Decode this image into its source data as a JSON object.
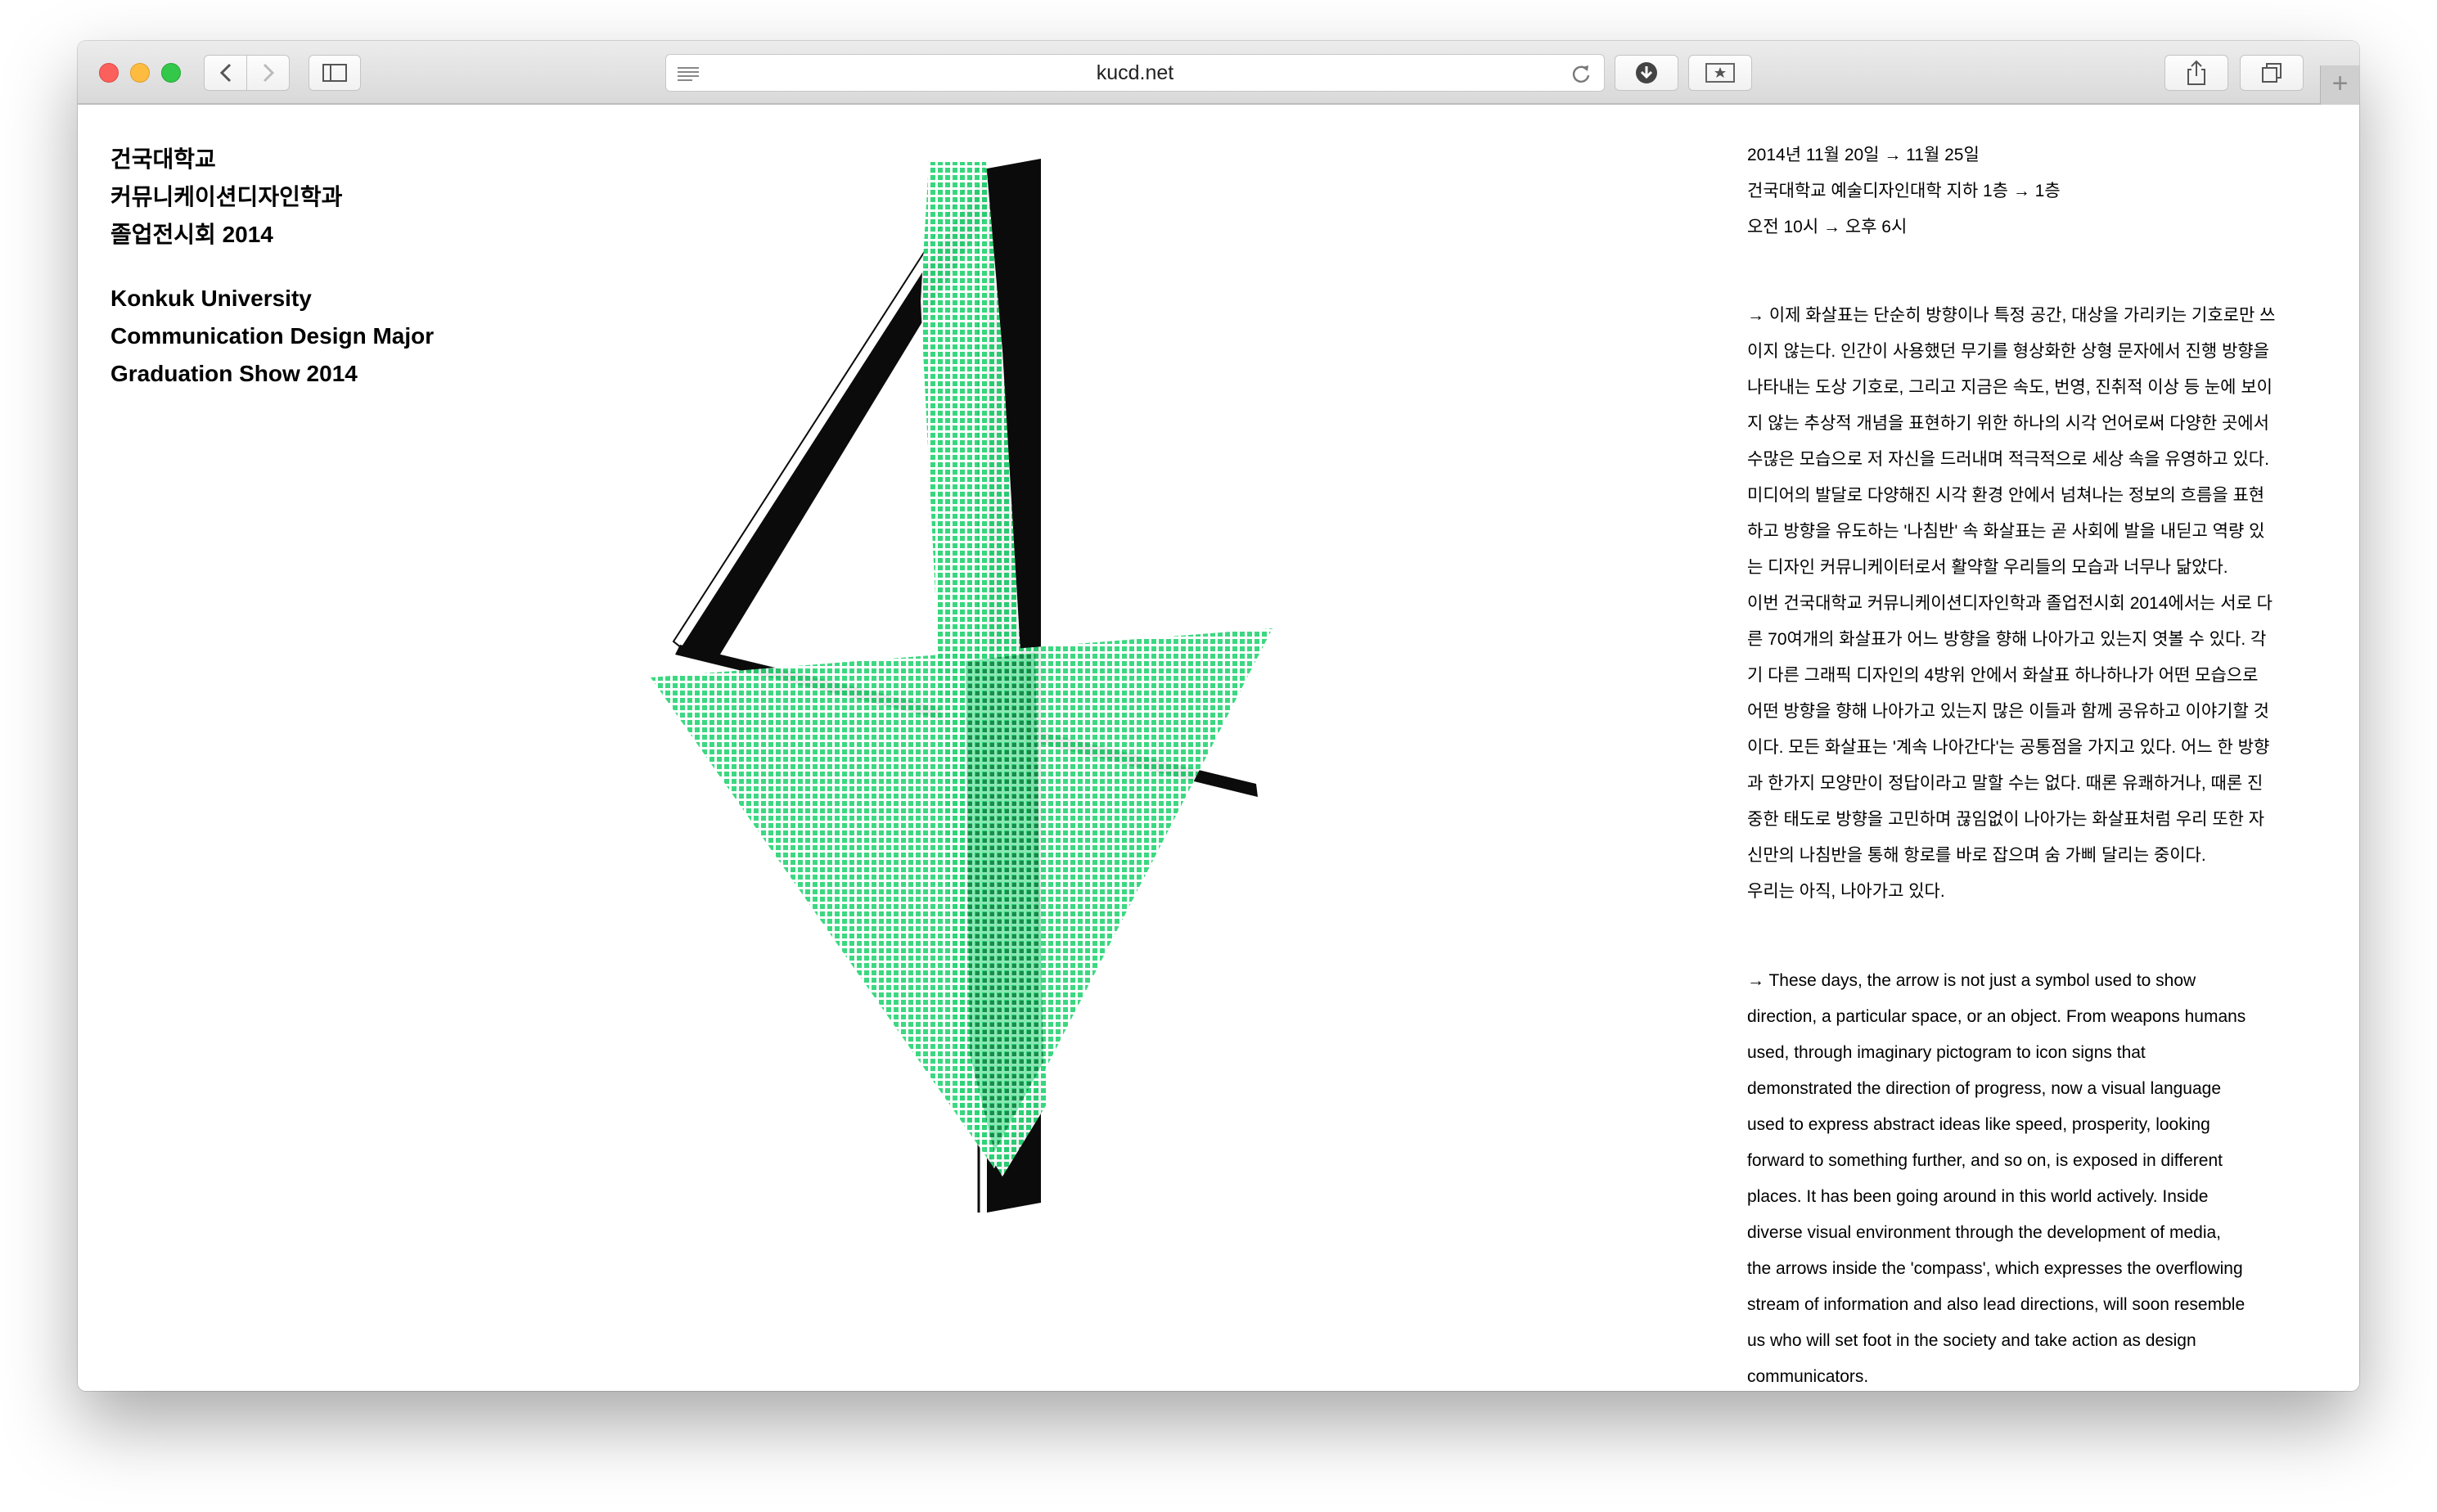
{
  "browser": {
    "url": "kucd.net",
    "new_tab_symbol": "+",
    "icons": {
      "back": "chevron-left-icon",
      "forward": "chevron-right-icon",
      "sidebar": "sidebar-icon",
      "reader": "reader-icon",
      "reload": "reload-icon",
      "downloads": "download-icon",
      "top_sites": "star-icon",
      "share": "share-icon",
      "tabs": "tabs-icon"
    }
  },
  "page": {
    "title_ko": [
      "건국대학교",
      "커뮤니케이션디자인학과",
      "졸업전시회 2014"
    ],
    "title_en": [
      "Konkuk University",
      "Communication Design Major",
      "Graduation Show 2014"
    ],
    "info": [
      "2014년 11월 20일 → 11월 25일",
      "건국대학교 예술디자인대학 지하 1층 → 1층",
      "오전 10시 → 오후 6시"
    ],
    "body_ko": [
      "→ 이제 화살표는 단순히 방향이나 특정 공간, 대상을 가리키는 기호로만 쓰",
      "이지 않는다. 인간이 사용했던 무기를 형상화한 상형 문자에서 진행 방향을",
      "나타내는 도상 기호로, 그리고 지금은 속도, 번영, 진취적 이상 등 눈에 보이",
      "지 않는 추상적 개념을 표현하기 위한 하나의 시각 언어로써 다양한 곳에서",
      "수많은 모습으로 저 자신을 드러내며 적극적으로 세상 속을 유영하고 있다.",
      "미디어의 발달로 다양해진 시각 환경 안에서 넘쳐나는 정보의 흐름을 표현",
      "하고 방향을 유도하는 '나침반' 속 화살표는 곧 사회에 발을 내딛고 역량 있",
      "는 디자인 커뮤니케이터로서 활약할 우리들의 모습과 너무나 닮았다.",
      "이번 건국대학교 커뮤니케이션디자인학과 졸업전시회 2014에서는 서로 다",
      "른 70여개의 화살표가 어느 방향을 향해 나아가고 있는지 엿볼 수 있다. 각",
      "기 다른 그래픽 디자인의 4방위 안에서 화살표 하나하나가 어떤 모습으로",
      "어떤 방향을 향해 나아가고 있는지 많은 이들과 함께 공유하고 이야기할 것",
      "이다. 모든 화살표는 '계속 나아간다'는 공통점을 가지고 있다. 어느 한 방향",
      "과 한가지 모양만이 정답이라고 말할 수는 없다. 때론 유쾌하거나, 때론 진",
      "중한 태도로 방향을 고민하며 끊임없이 나아가는 화살표처럼 우리 또한 자",
      "신만의 나침반을 통해 항로를 바로 잡으며 숨 가삐 달리는 중이다.",
      "우리는 아직, 나아가고 있다."
    ],
    "body_en": [
      "→ These days, the arrow is not just a symbol used to show",
      "direction, a particular space, or an object. From weapons humans",
      "used, through imaginary pictogram to icon signs that",
      "demonstrated the direction of progress, now a visual language",
      "used to express abstract ideas like speed, prosperity, looking",
      "forward to something further, and so on, is exposed in different",
      "places. It has been going around in this world actively. Inside",
      "diverse visual environment through the development of media,",
      "the arrows  inside the 'compass', which expresses the overflowing",
      "stream of information and also lead directions, will soon resemble",
      "us who will set foot in the society and take action as design",
      "communicators."
    ]
  },
  "colors": {
    "accent_green": "#2bd576",
    "dark_green": "#0f7a3d",
    "text": "#000000"
  }
}
